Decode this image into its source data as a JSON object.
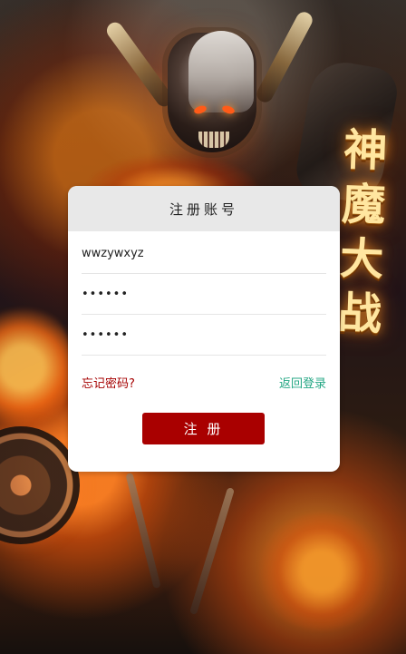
{
  "background": {
    "game_title_chars": [
      "神",
      "魔",
      "大",
      "战"
    ]
  },
  "form": {
    "title": "注册账号",
    "username_value": "wwzywxyz",
    "password_value": "••••••",
    "confirm_password_value": "••••••",
    "forgot_password_label": "忘记密码?",
    "back_login_label": "返回登录",
    "register_button_label": "注 册"
  },
  "colors": {
    "primary_button": "#a90000",
    "forgot_link": "#a50000",
    "back_link": "#24a784",
    "panel_header": "#e8e8e8"
  }
}
